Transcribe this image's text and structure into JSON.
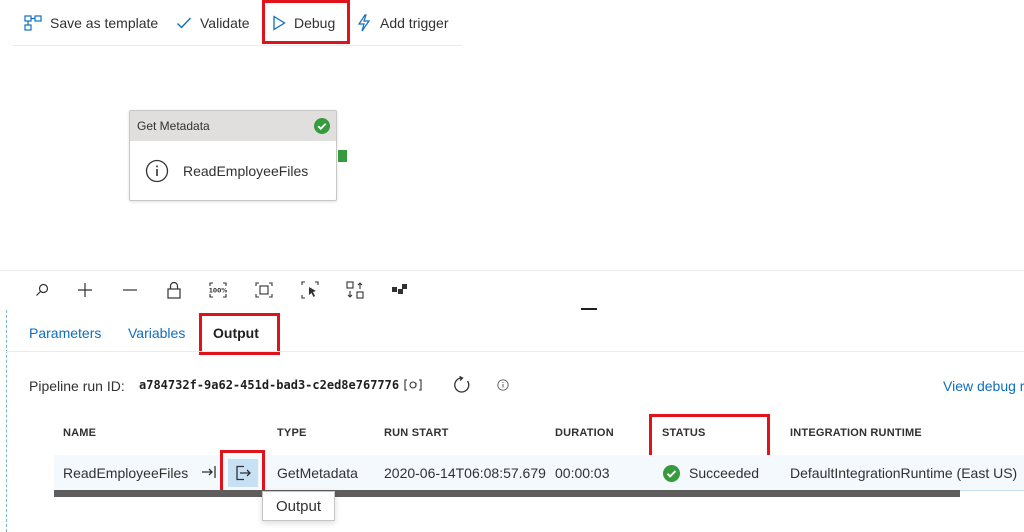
{
  "toolbar": {
    "save_template": "Save as template",
    "validate": "Validate",
    "debug": "Debug",
    "add_trigger": "Add trigger"
  },
  "activity": {
    "type_label": "Get Metadata",
    "name": "ReadEmployeeFiles"
  },
  "tabs": {
    "parameters": "Parameters",
    "variables": "Variables",
    "output": "Output"
  },
  "pipeline": {
    "run_id_label": "Pipeline run ID:",
    "run_id": "a784732f-9a62-451d-bad3-c2ed8e767776",
    "view_debug": "View debug r"
  },
  "table": {
    "headers": [
      "NAME",
      "TYPE",
      "RUN START",
      "DURATION",
      "STATUS",
      "INTEGRATION RUNTIME"
    ],
    "row": {
      "name": "ReadEmployeeFiles",
      "type": "GetMetadata",
      "run_start": "2020-06-14T06:08:57.679",
      "duration": "00:00:03",
      "status": "Succeeded",
      "integration_runtime": "DefaultIntegrationRuntime (East US)"
    }
  },
  "tooltip": "Output",
  "colors": {
    "accent": "#106ebe",
    "success": "#359b3d",
    "highlight": "#e0131a"
  }
}
